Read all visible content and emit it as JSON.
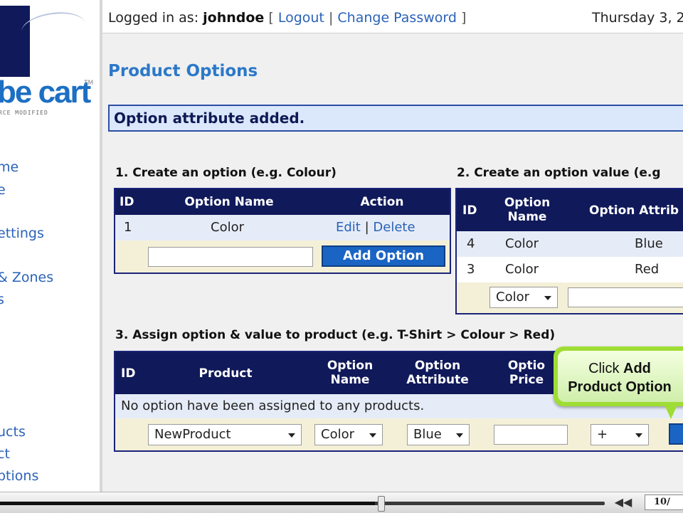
{
  "sidebar": {
    "logo": {
      "text": "be cart",
      "tm": "TM",
      "tagline": "RCE MODIFIED"
    },
    "nav": [
      "me",
      "e",
      "ettings",
      "& Zones",
      "s",
      "ucts",
      "ct",
      "ptions"
    ]
  },
  "header": {
    "logged_in_label": "Logged in as:",
    "username": "johndoe",
    "logout": "Logout",
    "change_password": "Change Password",
    "date": "Thursday 3, 2"
  },
  "page_title": "Product Options",
  "message": "Option attribute added.",
  "section1": {
    "title": "1. Create an option (e.g. Colour)",
    "headers": {
      "id": "ID",
      "name": "Option Name",
      "action": "Action"
    },
    "rows": [
      {
        "id": "1",
        "name": "Color",
        "edit": "Edit",
        "sep": "|",
        "delete": "Delete"
      }
    ],
    "button": "Add Option"
  },
  "section2": {
    "title": "2. Create an option value (e.g",
    "headers": {
      "id": "ID",
      "name": "Option Name",
      "attr": "Option Attrib"
    },
    "rows": [
      {
        "id": "4",
        "name": "Color",
        "attr": "Blue"
      },
      {
        "id": "3",
        "name": "Color",
        "attr": "Red"
      }
    ],
    "select": "Color"
  },
  "section3": {
    "title": "3. Assign option & value to product (e.g. T-Shirt > Colour > Red)",
    "headers": {
      "id": "ID",
      "product": "Product",
      "option_name": "Option Name",
      "option_attr": "Option Attribute",
      "option_price": "Optio Price"
    },
    "empty_message": "No option have been assigned to any products.",
    "selects": {
      "product": "NewProduct",
      "option": "Color",
      "attribute": "Blue",
      "sign": "+"
    }
  },
  "callout": {
    "prefix": "Click ",
    "bold1": "Add",
    "bold2": "Product Option"
  },
  "player": {
    "page_counter": "10/",
    "rewind": "◀◀",
    "progress": 0.62
  }
}
